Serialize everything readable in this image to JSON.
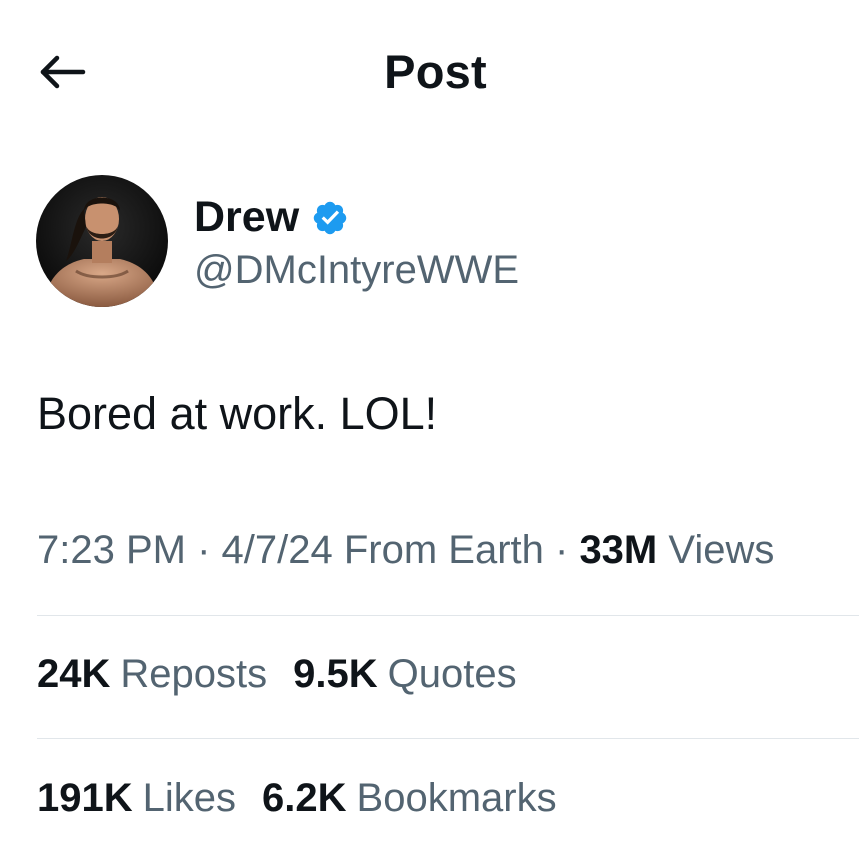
{
  "header": {
    "title": "Post",
    "back_icon": "arrow-left-icon"
  },
  "author": {
    "display_name": "Drew",
    "handle": "@DMcIntyreWWE",
    "verified_icon": "verified-badge-icon",
    "verified_color": "#1d9bf0"
  },
  "post": {
    "text": "Bored at work. LOL!"
  },
  "meta": {
    "time": "7:23 PM",
    "separator1": " · ",
    "date": "4/7/24",
    "source": " From Earth",
    "separator2": " · ",
    "views_count": "33M",
    "views_label": " Views"
  },
  "stats": {
    "reposts": {
      "count": "24K",
      "label": "Reposts"
    },
    "quotes": {
      "count": "9.5K",
      "label": "Quotes"
    },
    "likes": {
      "count": "191K",
      "label": "Likes"
    },
    "bookmarks": {
      "count": "6.2K",
      "label": "Bookmarks"
    }
  },
  "colors": {
    "text_primary": "#0f1419",
    "text_secondary": "#536471",
    "divider": "#e1e6ea",
    "accent": "#1d9bf0"
  }
}
